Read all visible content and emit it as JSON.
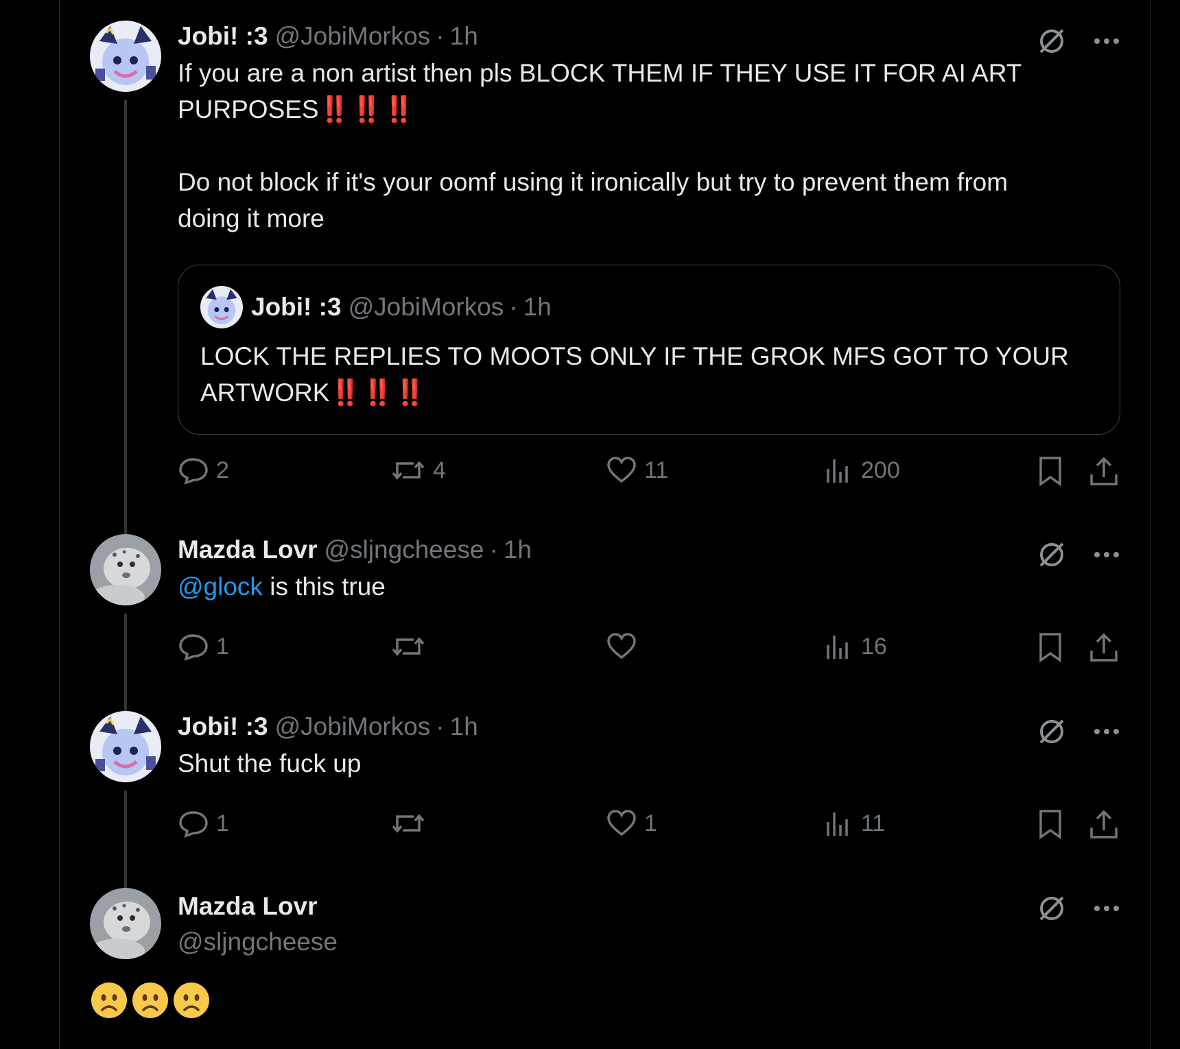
{
  "tweets": [
    {
      "name": "Jobi! :3",
      "handle": "@JobiMorkos",
      "dot": "·",
      "time": "1h",
      "text1": "If you are a non artist then pls BLOCK THEM IF THEY USE IT FOR AI ART\nPURPOSES",
      "text1_bang": "‼️‼️‼️",
      "text2": "Do not block if it's your oomf using it ironically but try to prevent them from\ndoing it more",
      "quote": {
        "name": "Jobi! :3",
        "handle": "@JobiMorkos",
        "dot": "·",
        "time": "1h",
        "text": "LOCK THE REPLIES TO MOOTS ONLY IF THE GROK MFS GOT TO YOUR\nARTWORK",
        "bang": "‼️‼️‼️"
      },
      "replies": "2",
      "reposts": "4",
      "likes": "11",
      "views": "200"
    },
    {
      "name": "Mazda Lovr",
      "handle": "@sljngcheese",
      "dot": "·",
      "time": "1h",
      "mention": "@glock",
      "text": " is this true",
      "replies": "1",
      "reposts": "",
      "likes": "",
      "views": "16"
    },
    {
      "name": "Jobi! :3",
      "handle": "@JobiMorkos",
      "dot": "·",
      "time": "1h",
      "text": "Shut the fuck up",
      "replies": "1",
      "reposts": "",
      "likes": "1",
      "views": "11"
    },
    {
      "name": "Mazda Lovr",
      "handle": "@sljngcheese",
      "emojis": [
        "🙁",
        "🙁",
        "🙁"
      ]
    }
  ],
  "icons": {
    "reply": "reply-icon",
    "repost": "repost-icon",
    "like": "heart-icon",
    "views": "views-icon",
    "bookmark": "bookmark-icon",
    "share": "share-icon",
    "grok": "grok-icon",
    "more": "more-icon"
  },
  "colors": {
    "background": "#000000",
    "text": "#e7e9ea",
    "muted": "#71767b",
    "mention": "#1d9bf0",
    "bang": "#d0202a",
    "border": "#2f3336"
  }
}
